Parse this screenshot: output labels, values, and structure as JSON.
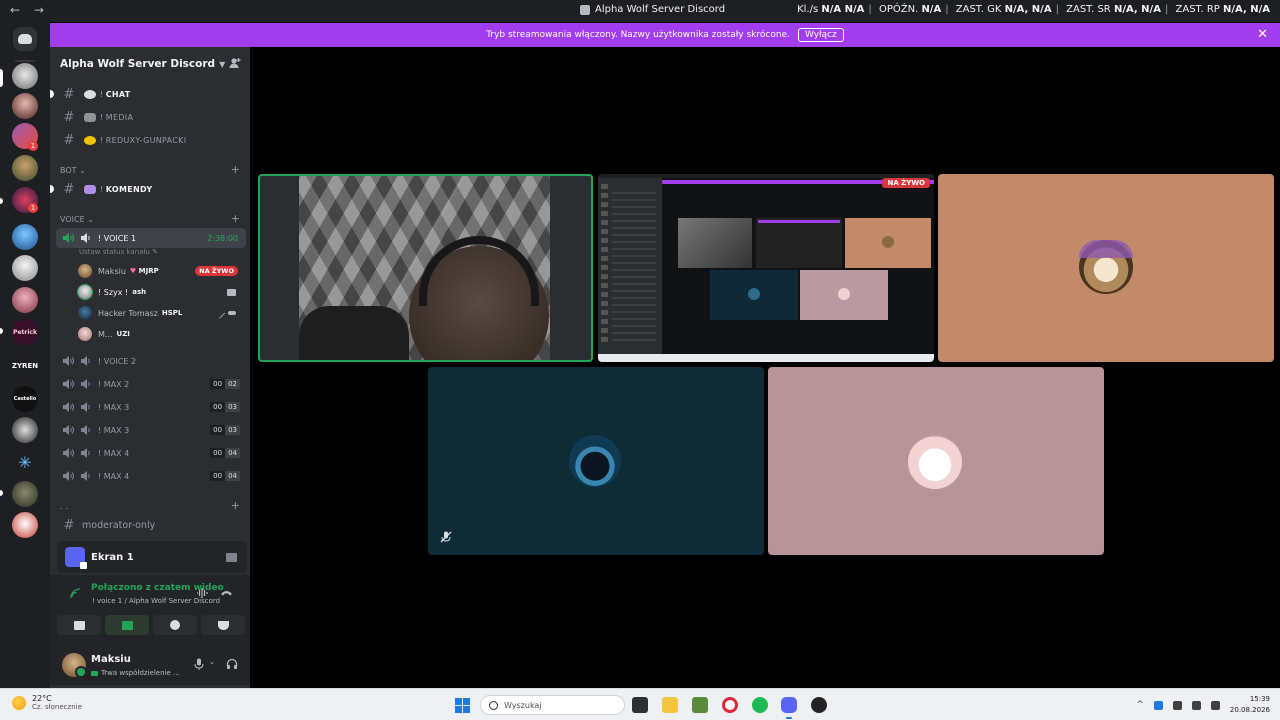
{
  "titlebar": {
    "back": "←",
    "forward": "→",
    "title": "Alpha Wolf Server Discord",
    "stats": {
      "kbs_label": "Kl./s",
      "kbs_value": "N/A N/A",
      "lag_label": "OPÓŹN.",
      "lag_value": "N/A",
      "gk_label": "ZAST. GK",
      "gk_value": "N/A, N/A",
      "sr_label": "ZAST. SR",
      "sr_value": "N/A, N/A",
      "rp_label": "ZAST. RP",
      "rp_value": "N/A, N/A"
    }
  },
  "banner": {
    "text": "Tryb streamowania włączony. Nazwy użytkownika zostały skrócone.",
    "button": "Wyłącz",
    "close": "✕"
  },
  "server": {
    "name": "Alpha Wolf Server Discord",
    "rail_labels": {
      "petrick": "Petrick",
      "zyren": "ZYREN",
      "castello": "Castello"
    },
    "rail_badge": "1",
    "rail_badge2": "1"
  },
  "channels": [
    {
      "prefix": "!",
      "label": "chat"
    },
    {
      "prefix": "!",
      "label": "media"
    },
    {
      "prefix": "!",
      "label": "reduxy-gunpacki"
    }
  ],
  "categories": {
    "bot": "BOT",
    "voice": "VOICE",
    "dots": ". ."
  },
  "bot_channel": {
    "prefix": "!",
    "label": "komendy"
  },
  "voice_active": {
    "prefix": "!",
    "label": "voice 1",
    "time": "2:38:00",
    "status_hint": "Ustaw status kanału"
  },
  "voice_users": [
    {
      "name": "Maksiu",
      "tag": "MJRP",
      "live": "NA ŻYWO"
    },
    {
      "name": "! Szyx !",
      "tag": "ash"
    },
    {
      "name": "Hacker Tomasz",
      "tag": "HSPL"
    },
    {
      "name": "M...",
      "tag": "UZI"
    }
  ],
  "voice_channels": [
    {
      "prefix": "!",
      "label": "voice 2",
      "a": "",
      "b": ""
    },
    {
      "prefix": "!",
      "label": "max 2",
      "a": "00",
      "b": "02"
    },
    {
      "prefix": "!",
      "label": "max 3",
      "a": "00",
      "b": "03"
    },
    {
      "prefix": "!",
      "label": "max 3",
      "a": "00",
      "b": "03"
    },
    {
      "prefix": "!",
      "label": "max 4",
      "a": "00",
      "b": "04"
    },
    {
      "prefix": "!",
      "label": "max 4",
      "a": "00",
      "b": "04"
    }
  ],
  "moderator_channel": {
    "label": "moderator-only"
  },
  "screen_panel": {
    "label": "Ekran 1"
  },
  "voice_panel": {
    "status": "Połączono z czatem wideo",
    "sub": "! voice 1 / Alpha Wolf Server Discord"
  },
  "user": {
    "name": "Maksiu",
    "status": "Trwa współdzielenie ..."
  },
  "stage": {
    "live_label": "NA ŻYWO"
  },
  "taskbar": {
    "temp": "22°C",
    "weather": "Cz. słonecznie",
    "search_placeholder": "Wyszukaj",
    "time": "15:39",
    "date": "20.08.2026"
  },
  "colors": {
    "accent": "#a13ded",
    "online": "#23a559",
    "live": "#da373c",
    "sidebar": "#2b2d31"
  }
}
